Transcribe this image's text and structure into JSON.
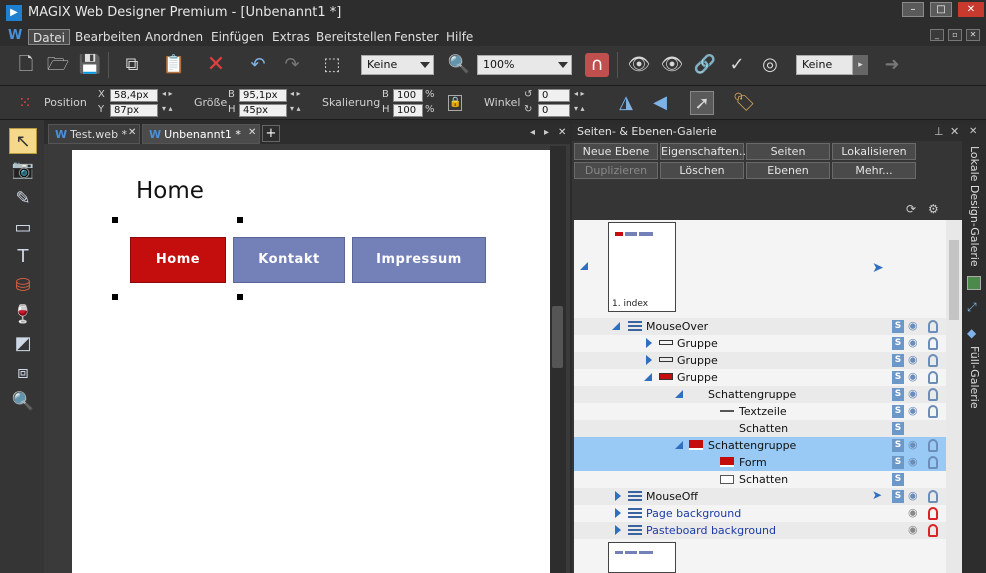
{
  "window": {
    "title": "MAGIX Web Designer Premium - [Unbenannt1 *]"
  },
  "menu": [
    "Datei",
    "Bearbeiten",
    "Anordnen",
    "Einfügen",
    "Extras",
    "Bereitstellen",
    "Fenster",
    "Hilfe"
  ],
  "toolbar1": {
    "fill_combo": "Keine",
    "zoom_combo": "100%",
    "outline_combo": "Keine"
  },
  "toolbar2": {
    "position_label": "Position",
    "x_label": "X",
    "x_value": "58,4px",
    "y_label": "Y",
    "y_value": "87px",
    "size_label": "Größe",
    "b_label": "B",
    "width_value": "95,1px",
    "h_label": "H",
    "height_value": "45px",
    "scale_label": "Skalierung",
    "scale_b_label": "B",
    "scale_b_value": "100",
    "scale_h_label": "H",
    "scale_h_value": "100",
    "percent": "%",
    "angle_label": "Winkel",
    "angle_value1": "0",
    "angle_value2": "0"
  },
  "doc_tabs": [
    {
      "label": "Test.web *"
    },
    {
      "label": "Unbenannt1 *"
    }
  ],
  "page": {
    "heading": "Home",
    "buttons": [
      {
        "label": "Home",
        "color": "#c40d0d"
      },
      {
        "label": "Kontakt",
        "color": "#7480b8"
      },
      {
        "label": "Impressum",
        "color": "#7480b8"
      }
    ]
  },
  "gallery": {
    "title": "Seiten- & Ebenen-Galerie",
    "buttons_row1": [
      "Neue Ebene",
      "Eigenschaften...",
      "Seiten",
      "Lokalisieren"
    ],
    "buttons_row2": [
      "Duplizieren",
      "Löschen",
      "Ebenen",
      "Mehr..."
    ],
    "page_thumb_label": "1. index",
    "tree": [
      {
        "label": "MouseOver",
        "indent": 0
      },
      {
        "label": "Gruppe",
        "indent": 1
      },
      {
        "label": "Gruppe",
        "indent": 1
      },
      {
        "label": "Gruppe",
        "indent": 1
      },
      {
        "label": "Schattengruppe",
        "indent": 2
      },
      {
        "label": "Textzeile",
        "indent": 3
      },
      {
        "label": "Schatten",
        "indent": 3
      },
      {
        "label": "Schattengruppe",
        "indent": 2
      },
      {
        "label": "Form",
        "indent": 3
      },
      {
        "label": "Schatten",
        "indent": 3
      },
      {
        "label": "MouseOff",
        "indent": 0
      },
      {
        "label": "Page background",
        "indent": 0
      },
      {
        "label": "Pasteboard background",
        "indent": 0
      }
    ],
    "s_badge": "S"
  },
  "right_tabs": [
    "Lokale Design-Galerie",
    "Füll-Galerie"
  ],
  "colors": {
    "accent_red": "#c40d0d",
    "accent_blue": "#7480b8",
    "selection": "#99c9f5"
  }
}
